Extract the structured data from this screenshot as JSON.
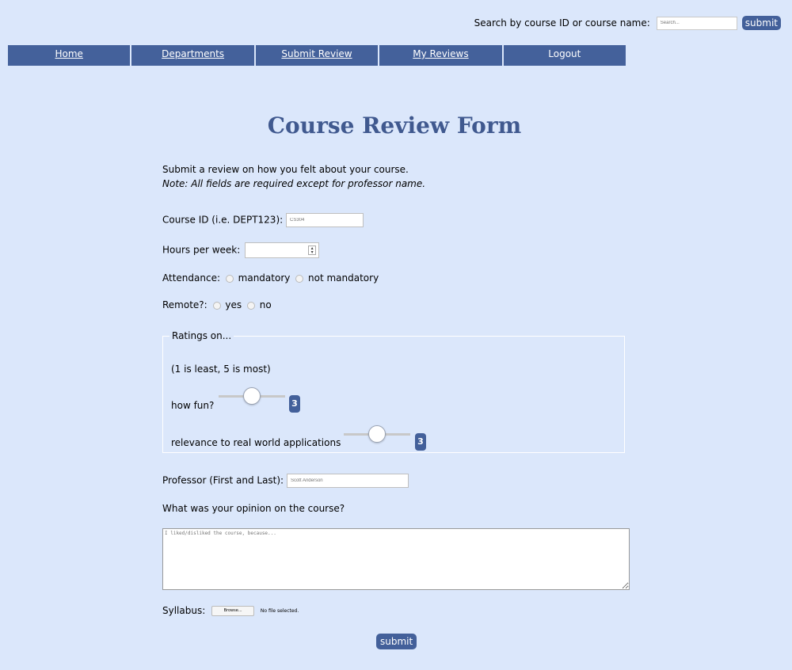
{
  "search": {
    "label": "Search by course ID or course name:",
    "placeholder": "Search...",
    "submit_label": "submit"
  },
  "nav": {
    "items": [
      "Home",
      "Departments",
      "Submit Review",
      "My Reviews",
      "Logout"
    ]
  },
  "form": {
    "title": "Course Review Form",
    "intro": "Submit a review on how you felt about your course.",
    "note": "Note: All fields are required except for professor name.",
    "course_id_label": "Course ID (i.e. DEPT123):",
    "course_id_placeholder": "CS304",
    "hours_label": "Hours per week:",
    "attendance_label": "Attendance:",
    "attendance_options": [
      "mandatory",
      "not mandatory"
    ],
    "remote_label": "Remote?:",
    "remote_options": [
      "yes",
      "no"
    ],
    "ratings": {
      "legend": "Ratings on...",
      "scale_note": "(1 is least, 5 is most)",
      "fun_label": "how fun?",
      "fun_value": "3",
      "relevance_label": "relevance to real world applications",
      "relevance_value": "3",
      "slider_max": 5
    },
    "professor_label": "Professor (First and Last):",
    "professor_placeholder": "Scott Anderson",
    "opinion_label": "What was your opinion on the course?",
    "opinion_placeholder": "I liked/disliked the course, because...",
    "syllabus_label": "Syllabus:",
    "browse_label": "Browse...",
    "file_status": "No file selected.",
    "submit_label": "submit"
  }
}
